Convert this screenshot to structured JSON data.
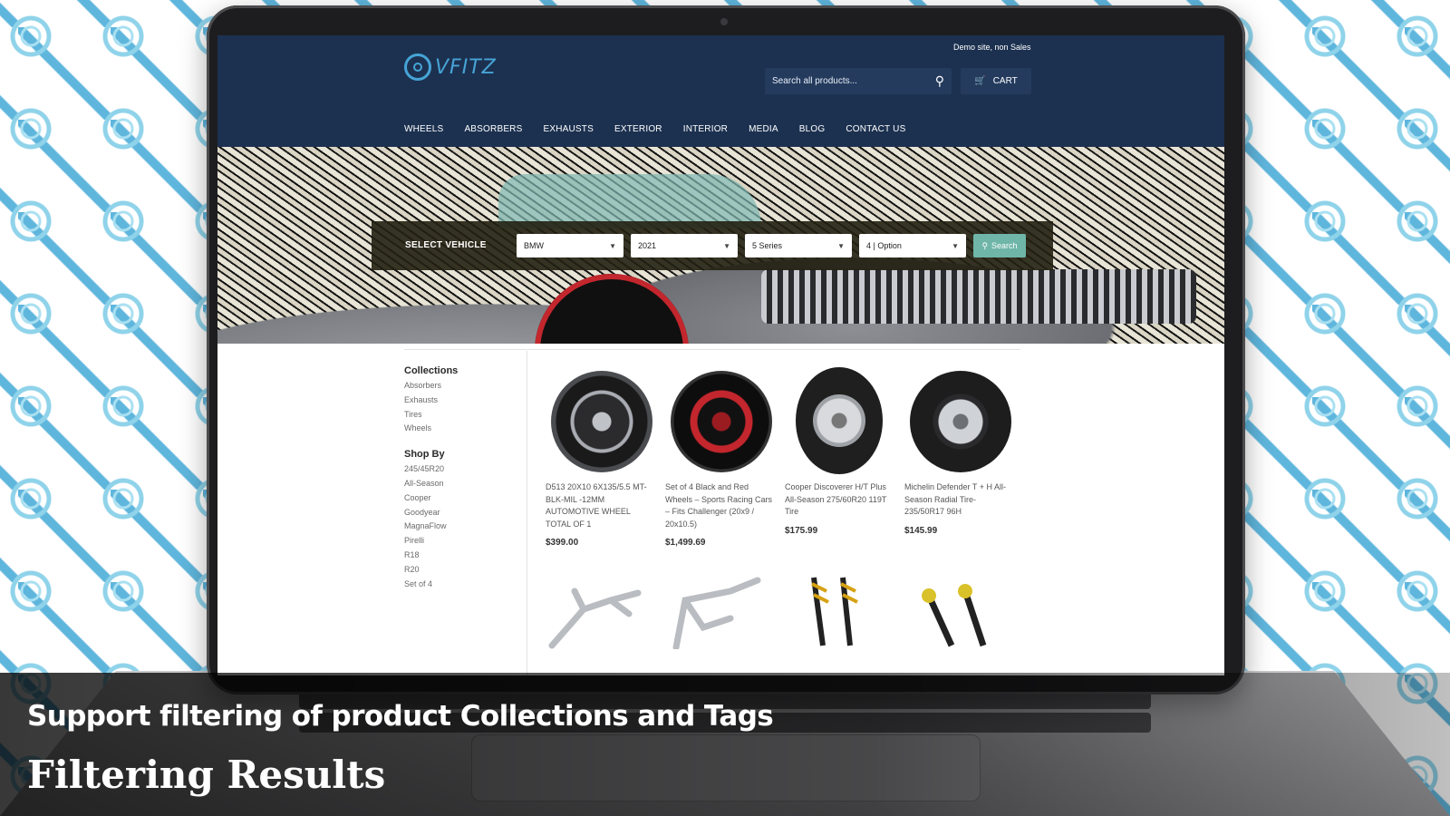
{
  "site": {
    "demo_note": "Demo site, non Sales",
    "logo_text": "VFITZ",
    "search_placeholder": "Search all products...",
    "cart_label": "CART",
    "nav": [
      "WHEELS",
      "ABSORBERS",
      "EXHAUSTS",
      "EXTERIOR",
      "INTERIOR",
      "MEDIA",
      "BLOG",
      "CONTACT US"
    ]
  },
  "vehicle_selector": {
    "label": "SELECT VEHICLE",
    "selects": [
      "BMW",
      "2021",
      "5 Series",
      "4 | Option"
    ],
    "search_label": "Search"
  },
  "sidebar": {
    "collections_heading": "Collections",
    "collections": [
      "Absorbers",
      "Exhausts",
      "Tires",
      "Wheels"
    ],
    "shop_by_heading": "Shop By",
    "shop_by": [
      "245/45R20",
      "All-Season",
      "Cooper",
      "Goodyear",
      "MagnaFlow",
      "Pirelli",
      "R18",
      "R20",
      "Set of 4"
    ]
  },
  "products": [
    {
      "title": "D513 20X10 6X135/5.5 MT-BLK-MIL -12MM AUTOMOTIVE WHEEL TOTAL OF 1",
      "price": "$399.00"
    },
    {
      "title": "Set of 4 Black and Red Wheels – Sports Racing Cars – Fits Challenger (20x9 / 20x10.5)",
      "price": "$1,499.69"
    },
    {
      "title": "Cooper Discoverer H/T Plus All-Season 275/60R20 119T Tire",
      "price": "$175.99"
    },
    {
      "title": "Michelin Defender T + H All- Season Radial Tire-235/50R17 96H",
      "price": "$145.99"
    }
  ],
  "captions": {
    "primary": "Support filtering of  product Collections and Tags",
    "secondary": "Filtering Results"
  },
  "colors": {
    "header_bg": "#1c3150",
    "accent": "#46a4d6",
    "search_button": "#6fb6a8"
  }
}
